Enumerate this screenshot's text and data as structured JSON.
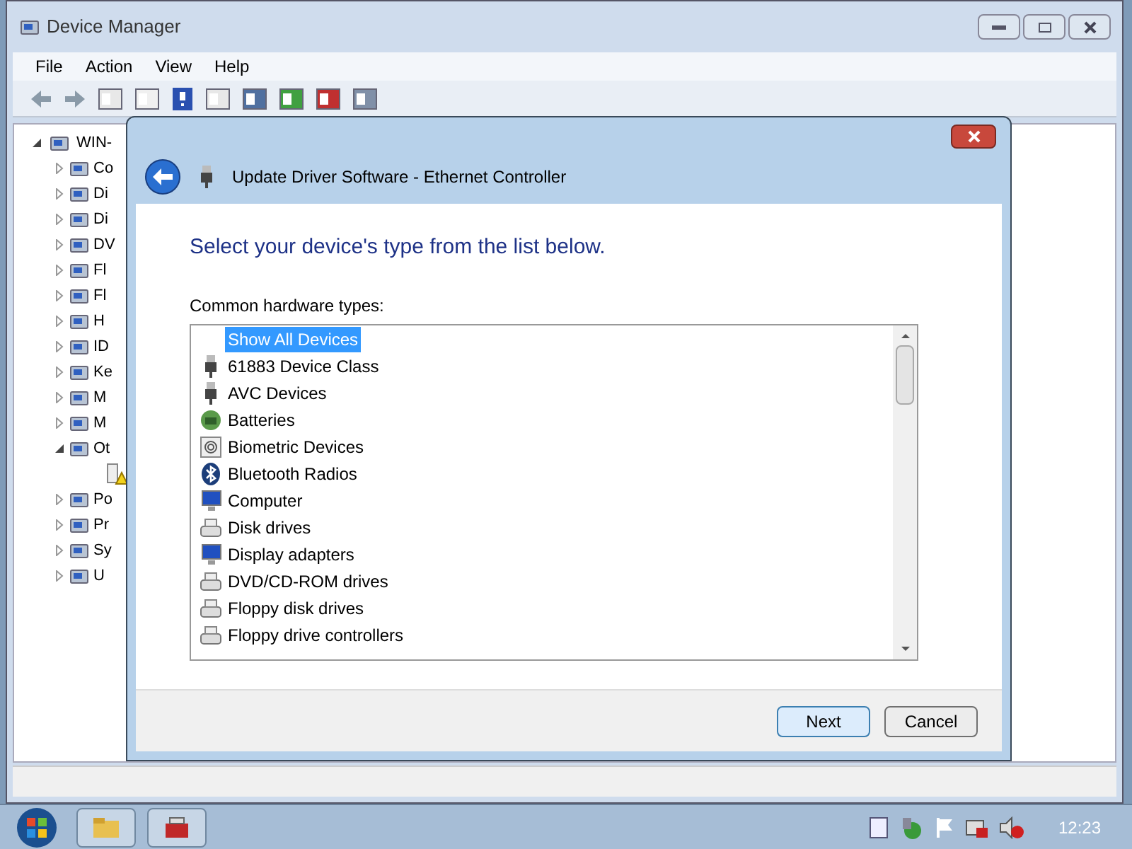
{
  "window": {
    "title": "Device Manager"
  },
  "menu": [
    "File",
    "Action",
    "View",
    "Help"
  ],
  "tree": {
    "label": "WIN-",
    "expanded": true,
    "children": [
      {
        "label": "Co",
        "expanded": false
      },
      {
        "label": "Di",
        "expanded": false
      },
      {
        "label": "Di",
        "expanded": false
      },
      {
        "label": "DV",
        "expanded": false
      },
      {
        "label": "Fl",
        "expanded": false
      },
      {
        "label": "Fl",
        "expanded": false
      },
      {
        "label": "H",
        "expanded": false
      },
      {
        "label": "ID",
        "expanded": false
      },
      {
        "label": "Ke",
        "expanded": false
      },
      {
        "label": "M",
        "expanded": false
      },
      {
        "label": "M",
        "expanded": false
      },
      {
        "label": "Ot",
        "expanded": true,
        "children": [
          {
            "kind": "warning"
          }
        ]
      },
      {
        "label": "Po",
        "expanded": false
      },
      {
        "label": "Pr",
        "expanded": false
      },
      {
        "label": "Sy",
        "expanded": false
      },
      {
        "label": "U",
        "expanded": false
      }
    ]
  },
  "dialog": {
    "title": "Update Driver Software - Ethernet Controller",
    "heading": "Select your device's type from the list below.",
    "list_label": "Common hardware types:",
    "items": [
      {
        "label": "Show All Devices",
        "selected": true,
        "kind": "none"
      },
      {
        "label": "61883 Device Class",
        "selected": false,
        "kind": "plug"
      },
      {
        "label": "AVC Devices",
        "selected": false,
        "kind": "plug"
      },
      {
        "label": "Batteries",
        "selected": false,
        "kind": "battery"
      },
      {
        "label": "Biometric Devices",
        "selected": false,
        "kind": "fingerprint"
      },
      {
        "label": "Bluetooth Radios",
        "selected": false,
        "kind": "bluetooth"
      },
      {
        "label": "Computer",
        "selected": false,
        "kind": "monitor"
      },
      {
        "label": "Disk drives",
        "selected": false,
        "kind": "drive"
      },
      {
        "label": "Display adapters",
        "selected": false,
        "kind": "monitor"
      },
      {
        "label": "DVD/CD-ROM drives",
        "selected": false,
        "kind": "drive"
      },
      {
        "label": "Floppy disk drives",
        "selected": false,
        "kind": "drive"
      },
      {
        "label": "Floppy drive controllers",
        "selected": false,
        "kind": "drive"
      }
    ],
    "buttons": [
      {
        "label": "Next",
        "selected": true
      },
      {
        "label": "Cancel",
        "selected": false
      }
    ]
  },
  "taskbar": {
    "clock": "12:23"
  }
}
